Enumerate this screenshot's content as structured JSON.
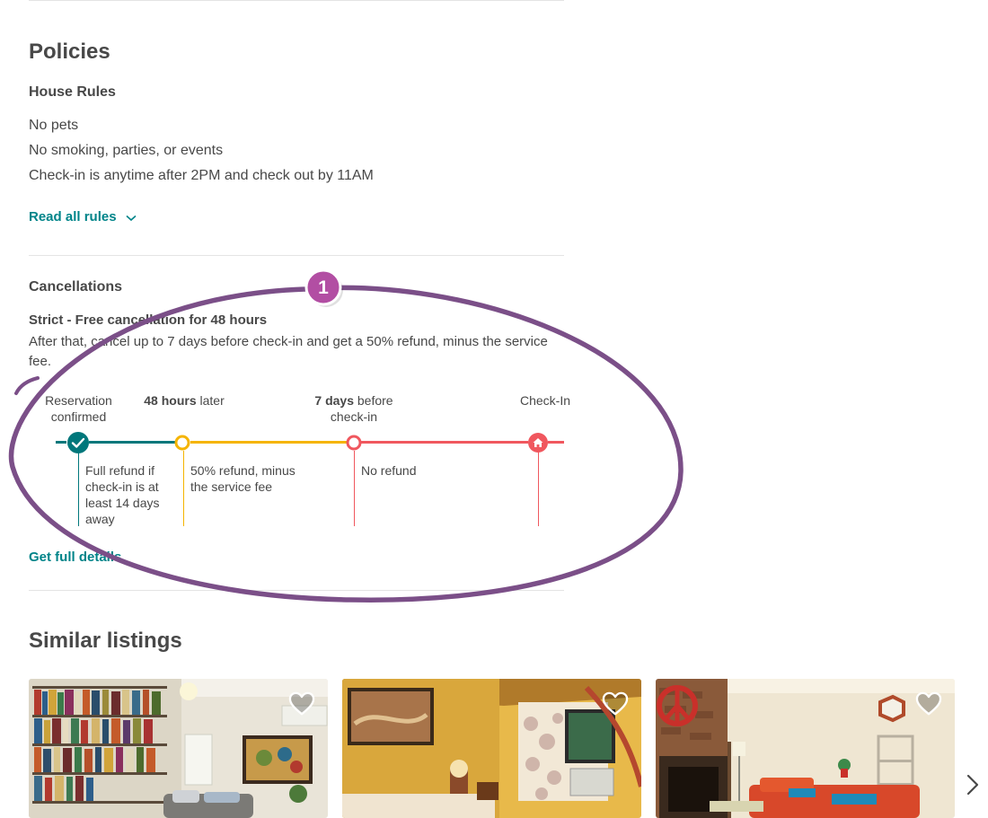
{
  "policies": {
    "title": "Policies",
    "house_rules": {
      "heading": "House Rules",
      "rules": [
        "No pets",
        "No smoking, parties, or events",
        "Check-in is anytime after 2PM and check out by 11AM"
      ],
      "read_all_label": "Read all rules"
    },
    "cancellations": {
      "heading": "Cancellations",
      "policy_title": "Strict - Free cancellation for 48 hours",
      "policy_description": "After that, cancel up to 7 days before check-in and get a 50% refund, minus the service fee.",
      "timeline": {
        "stage1_label": "Reservation confirmed",
        "stage2_bold": "48 hours",
        "stage2_rest": " later",
        "stage3_bold": "7 days",
        "stage3_rest": " before check-in",
        "stage4_label": "Check-In",
        "refund1": "Full refund if check-in is at least 14 days away",
        "refund2": "50% refund, minus the service fee",
        "refund3": "No refund",
        "colors": {
          "teal": "#00777b",
          "yellow": "#f5b400",
          "red": "#f0575e"
        }
      },
      "details_label": "Get full details"
    }
  },
  "annotation": {
    "badge_number": "1",
    "color": "#7b4f88"
  },
  "similar_listings": {
    "title": "Similar listings",
    "cards": [
      {
        "name": "listing-1",
        "icon": "heart-icon"
      },
      {
        "name": "listing-2",
        "icon": "heart-icon"
      },
      {
        "name": "listing-3",
        "icon": "heart-icon"
      }
    ],
    "next_icon": "chevron-right-icon"
  }
}
